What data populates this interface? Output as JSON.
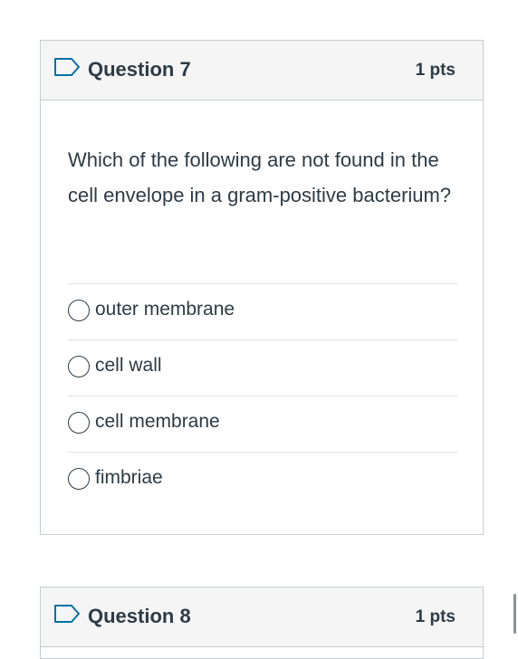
{
  "questions": [
    {
      "title": "Question 7",
      "points": "1 pts",
      "text": "Which of the following are not found in the cell envelope in a gram-positive bacterium?",
      "answers": [
        {
          "label": "outer membrane"
        },
        {
          "label": "cell wall"
        },
        {
          "label": "cell membrane"
        },
        {
          "label": "fimbriae"
        }
      ]
    },
    {
      "title": "Question 8",
      "points": "1 pts"
    }
  ],
  "icons": {
    "flag": "flag-icon",
    "radio": "radio-unchecked-icon"
  },
  "colors": {
    "accent": "#0770a3",
    "text": "#2d3b45",
    "border": "#c7cdd1",
    "header_bg": "#f5f5f5"
  }
}
